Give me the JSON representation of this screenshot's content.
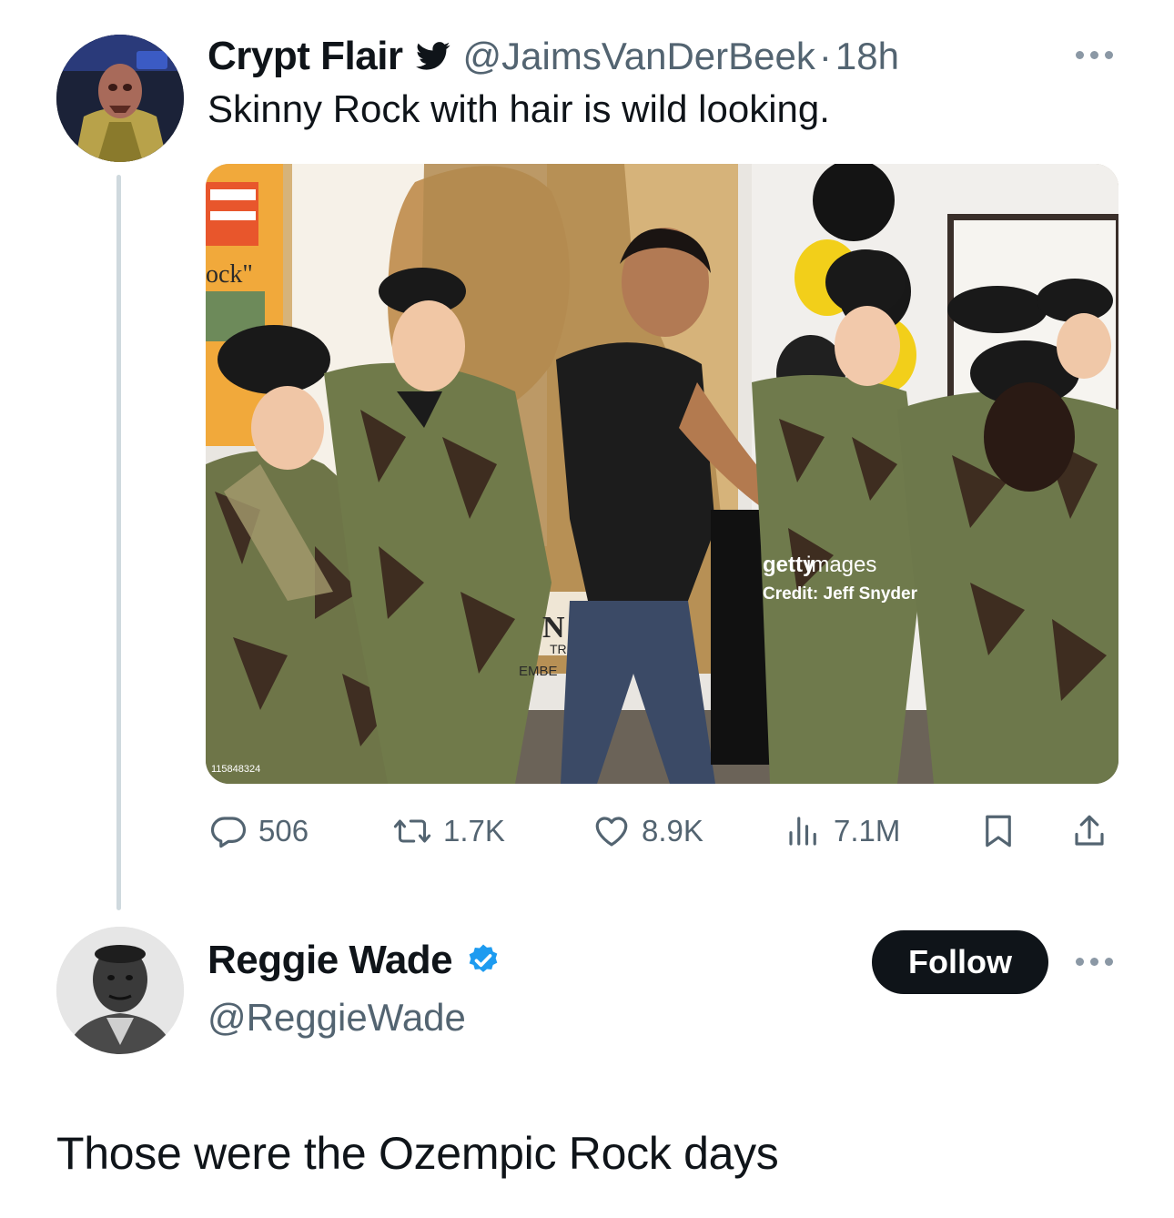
{
  "colors": {
    "text": "#0f1419",
    "muted": "#536471",
    "thread_line": "#cfd9de",
    "verified": "#1d9bf0",
    "follow_bg": "#0f1419"
  },
  "tweet": {
    "author_name": "Crypt Flair",
    "author_badge_icon": "twitter-bird-icon",
    "handle": "@JaimsVanDerBeek",
    "separator": "·",
    "time": "18h",
    "text": "Skinny Rock with hair is wild looking.",
    "image": {
      "description_icon": "photo",
      "watermark_brand_a": "getty",
      "watermark_brand_b": "images",
      "watermark_credit": "Credit: Jeff Snyder",
      "image_id": "115848324",
      "poster_text_top": "ock\"",
      "poster_text_mid": "N",
      "poster_text_tr": "TR",
      "poster_text_embe": "EMBE"
    },
    "stats": {
      "replies": "506",
      "retweets": "1.7K",
      "likes": "8.9K",
      "views": "7.1M"
    }
  },
  "reply": {
    "author_name": "Reggie Wade",
    "verified": true,
    "handle": "@ReggieWade",
    "follow_label": "Follow",
    "text": "Those were the Ozempic Rock days"
  }
}
